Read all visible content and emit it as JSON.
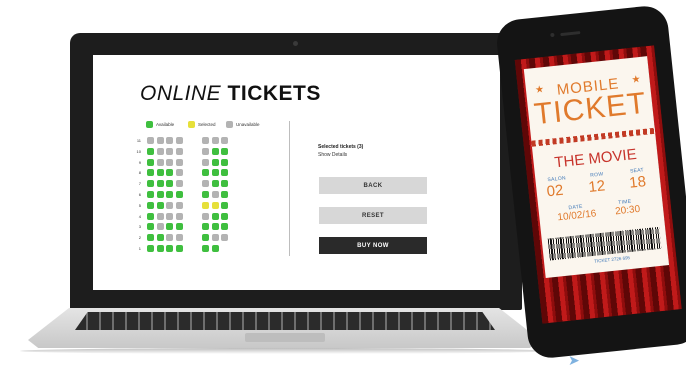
{
  "screen": {
    "title_italic": "ONLINE",
    "title_bold": "TICKETS",
    "legend": [
      {
        "label": "Available",
        "color": "#3fbf3f"
      },
      {
        "label": "Selected",
        "color": "#e6e03a"
      },
      {
        "label": "Unavailable",
        "color": "#b3b3b3"
      }
    ],
    "row_labels": [
      "11",
      "10",
      "9",
      "8",
      "7",
      "6",
      "5",
      "4",
      "3",
      "2",
      "1"
    ],
    "selected_tickets": "Selected tickets (3)",
    "show_details": "Show Details",
    "buttons": {
      "back": "BACK",
      "reset": "RESET",
      "buy_now": "BUY NOW"
    },
    "colors": {
      "available": "#3fbf3f",
      "selected": "#e6e03a",
      "unavailable": "#b3b3b3"
    }
  },
  "ticket": {
    "mobile": "MOBILE",
    "ticket": "TICKET",
    "movie": "THE MOVIE",
    "salon_label": "SALON",
    "salon_value": "02",
    "row_label": "ROW",
    "row_value": "12",
    "seat_label": "SEAT",
    "seat_value": "18",
    "date_label": "DATE",
    "date_value": "10/02/16",
    "time_label": "TIME",
    "time_value": "20:30",
    "ticket_number": "TICKET 2726 695"
  }
}
